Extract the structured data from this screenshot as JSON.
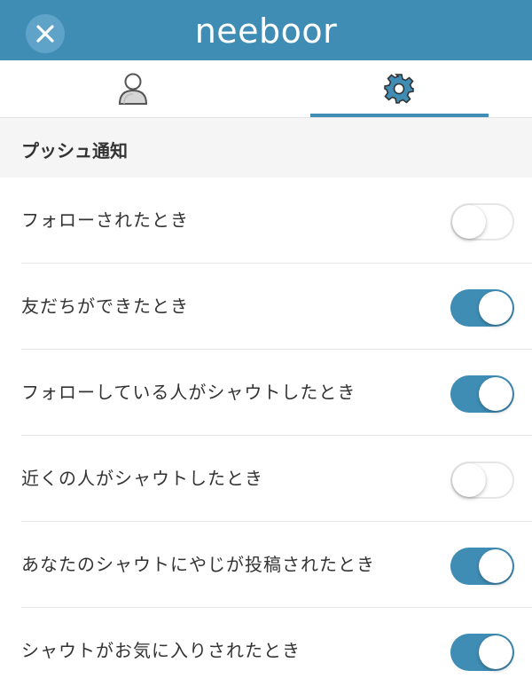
{
  "header": {
    "logo_text": "neeboor",
    "close_icon": "close-icon",
    "color": "#3f8db5"
  },
  "tabs": [
    {
      "icon": "user-profile-icon",
      "selected": false
    },
    {
      "icon": "gear-icon",
      "selected": true
    }
  ],
  "section": {
    "title": "プッシュ通知"
  },
  "settings": [
    {
      "label": "フォローされたとき",
      "enabled": false
    },
    {
      "label": "友だちができたとき",
      "enabled": true
    },
    {
      "label": "フォローしている人がシャウトしたとき",
      "enabled": true
    },
    {
      "label": "近くの人がシャウトしたとき",
      "enabled": false
    },
    {
      "label": "あなたのシャウトにやじが投稿されたとき",
      "enabled": true
    },
    {
      "label": "シャウトがお気に入りされたとき",
      "enabled": true
    }
  ],
  "colors": {
    "accent": "#3f8db5",
    "section_bg": "#f5f5f5",
    "toggle_off_border": "#e6e6e6"
  }
}
